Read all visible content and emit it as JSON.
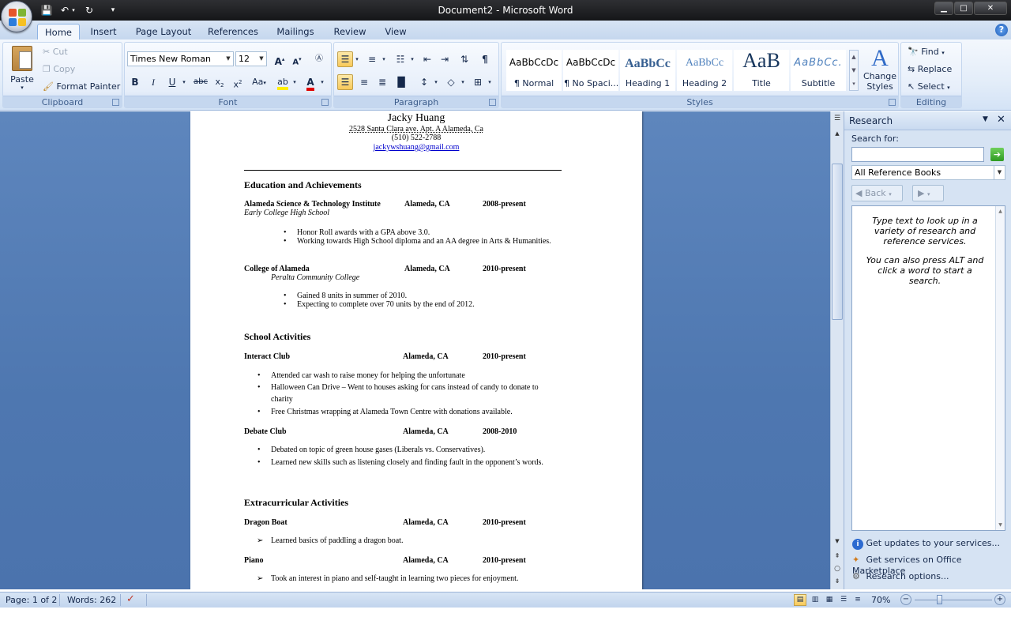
{
  "window": {
    "title": "Document2 - Microsoft Word"
  },
  "qat": {
    "save_icon": "save-icon",
    "undo_icon": "undo-icon",
    "redo_icon": "redo-icon"
  },
  "tabs": [
    {
      "label": "Home"
    },
    {
      "label": "Insert"
    },
    {
      "label": "Page Layout"
    },
    {
      "label": "References"
    },
    {
      "label": "Mailings"
    },
    {
      "label": "Review"
    },
    {
      "label": "View"
    }
  ],
  "ribbon": {
    "clipboard": {
      "label": "Clipboard",
      "paste": "Paste",
      "cut": "Cut",
      "copy": "Copy",
      "format_painter": "Format Painter"
    },
    "font": {
      "label": "Font",
      "font_name": "Times New Roman",
      "font_size": "12"
    },
    "paragraph": {
      "label": "Paragraph"
    },
    "styles": {
      "label": "Styles",
      "items": [
        {
          "preview": "AaBbCcDc",
          "name": "¶ Normal"
        },
        {
          "preview": "AaBbCcDc",
          "name": "¶ No Spaci..."
        },
        {
          "preview": "AaBbCc",
          "name": "Heading 1"
        },
        {
          "preview": "AaBbCc",
          "name": "Heading 2"
        },
        {
          "preview": "AaB",
          "name": "Title"
        },
        {
          "preview": "AaBbCc.",
          "name": "Subtitle"
        }
      ],
      "change_styles": "Change Styles"
    },
    "editing": {
      "label": "Editing",
      "find": "Find",
      "replace": "Replace",
      "select": "Select"
    }
  },
  "document": {
    "name": "Jacky Huang",
    "address": "2528 Santa Clara ave. Apt. A Alameda, Ca",
    "phone": "(510) 522-2788",
    "email": "jackywshuang@gmail.com",
    "sections": {
      "education": "Education and Achievements",
      "school_activities": "School Activities",
      "extracurricular": "Extracurricular Activities"
    },
    "entries": {
      "asti": {
        "org": "Alameda Science & Technology Institute",
        "loc": "Alameda, CA",
        "date": "2008-present",
        "sub": "Early College High School",
        "bullets": [
          "Honor Roll awards with a GPA above 3.0.",
          "Working towards High School diploma and an AA degree in Arts & Humanities."
        ]
      },
      "coa": {
        "org": "College of Alameda",
        "loc": "Alameda, CA",
        "date": "2010-present",
        "sub": "Peralta Community College",
        "bullets": [
          "Gained 8 units in summer of 2010.",
          "Expecting to complete over 70 units by the end of 2012."
        ]
      },
      "interact": {
        "org": "Interact Club",
        "loc": "Alameda, CA",
        "date": "2010-present",
        "bullets": [
          "Attended car wash to raise money for helping the unfortunate",
          "Halloween Can Drive – Went to houses asking for cans instead of candy to donate to",
          "charity",
          "Free Christmas wrapping at Alameda Town Centre with donations available."
        ]
      },
      "debate": {
        "org": "Debate Club",
        "loc": "Alameda, CA",
        "date": "2008-2010",
        "bullets": [
          "Debated on topic of green house gases (Liberals vs. Conservatives).",
          "Learned new skills such as listening closely and finding fault in the opponent’s words."
        ]
      },
      "dragon": {
        "org": "Dragon Boat",
        "loc": "Alameda, CA",
        "date": "2010-present",
        "bullets": [
          "Learned basics of paddling a dragon boat."
        ]
      },
      "piano": {
        "org": "Piano",
        "loc": "Alameda, CA",
        "date": "2010-present",
        "bullets": [
          "Took an interest in piano and self-taught in learning two pieces for enjoyment."
        ]
      }
    }
  },
  "research": {
    "title": "Research",
    "search_for": "Search for:",
    "search_value": "",
    "reference": "All Reference Books",
    "back": "Back",
    "hint1": "Type text to look up in a variety of research and reference services.",
    "hint2": "You can also press ALT and click a word to start a search.",
    "links": [
      "Get updates to your services...",
      "Get services on Office Marketplace",
      "Research options..."
    ]
  },
  "status": {
    "page": "Page: 1 of 2",
    "words": "Words: 262",
    "zoom": "70%"
  }
}
